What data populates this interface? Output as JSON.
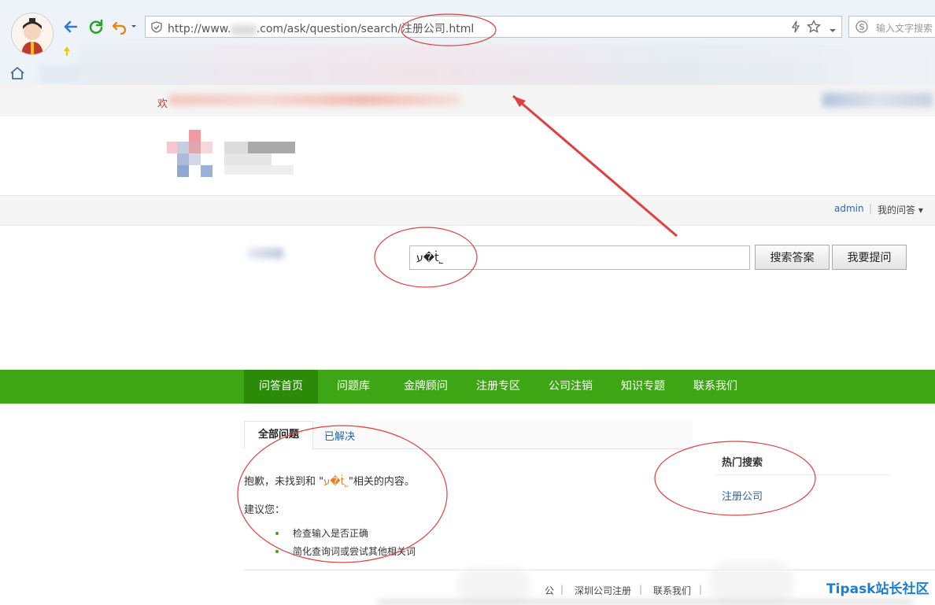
{
  "browser": {
    "url_prefix": "http://www.",
    "url_suffix": ".com/ask/question/search/注册公司.html",
    "search_placeholder": "输入文字搜索"
  },
  "site": {
    "welcome": "欢",
    "user": {
      "name": "admin",
      "separator": "|",
      "my_questions": "我的问答 ▾"
    }
  },
  "search": {
    "value": "ע�ṫ˾",
    "search_button": "搜索答案",
    "ask_button": "我要提问"
  },
  "nav": [
    "问答首页",
    "问题库",
    "金牌顾问",
    "注册专区",
    "公司注销",
    "知识专题",
    "联系我们"
  ],
  "tabs": {
    "all": "全部问题",
    "solved": "已解决"
  },
  "result": {
    "sorry_prefix": "抱歉，未找到和 \"",
    "keyword": "ע�ṫ˾",
    "sorry_suffix": "\"相关的内容。",
    "suggest": "建议您：",
    "tips": [
      "检查输入是否正确",
      "简化查询词或尝试其他相关词"
    ]
  },
  "hot": {
    "title": "热门搜索",
    "items": [
      "注册公司"
    ]
  },
  "footer": {
    "links": [
      "公",
      "|",
      "深圳公司注册",
      "|",
      "联系我们",
      "|"
    ],
    "brand": "Tipask站长社区"
  },
  "colors": {
    "nav_green": "#3ea614",
    "nav_active": "#2b8a08",
    "annotation": "#e04040",
    "link": "#2a63a8"
  }
}
